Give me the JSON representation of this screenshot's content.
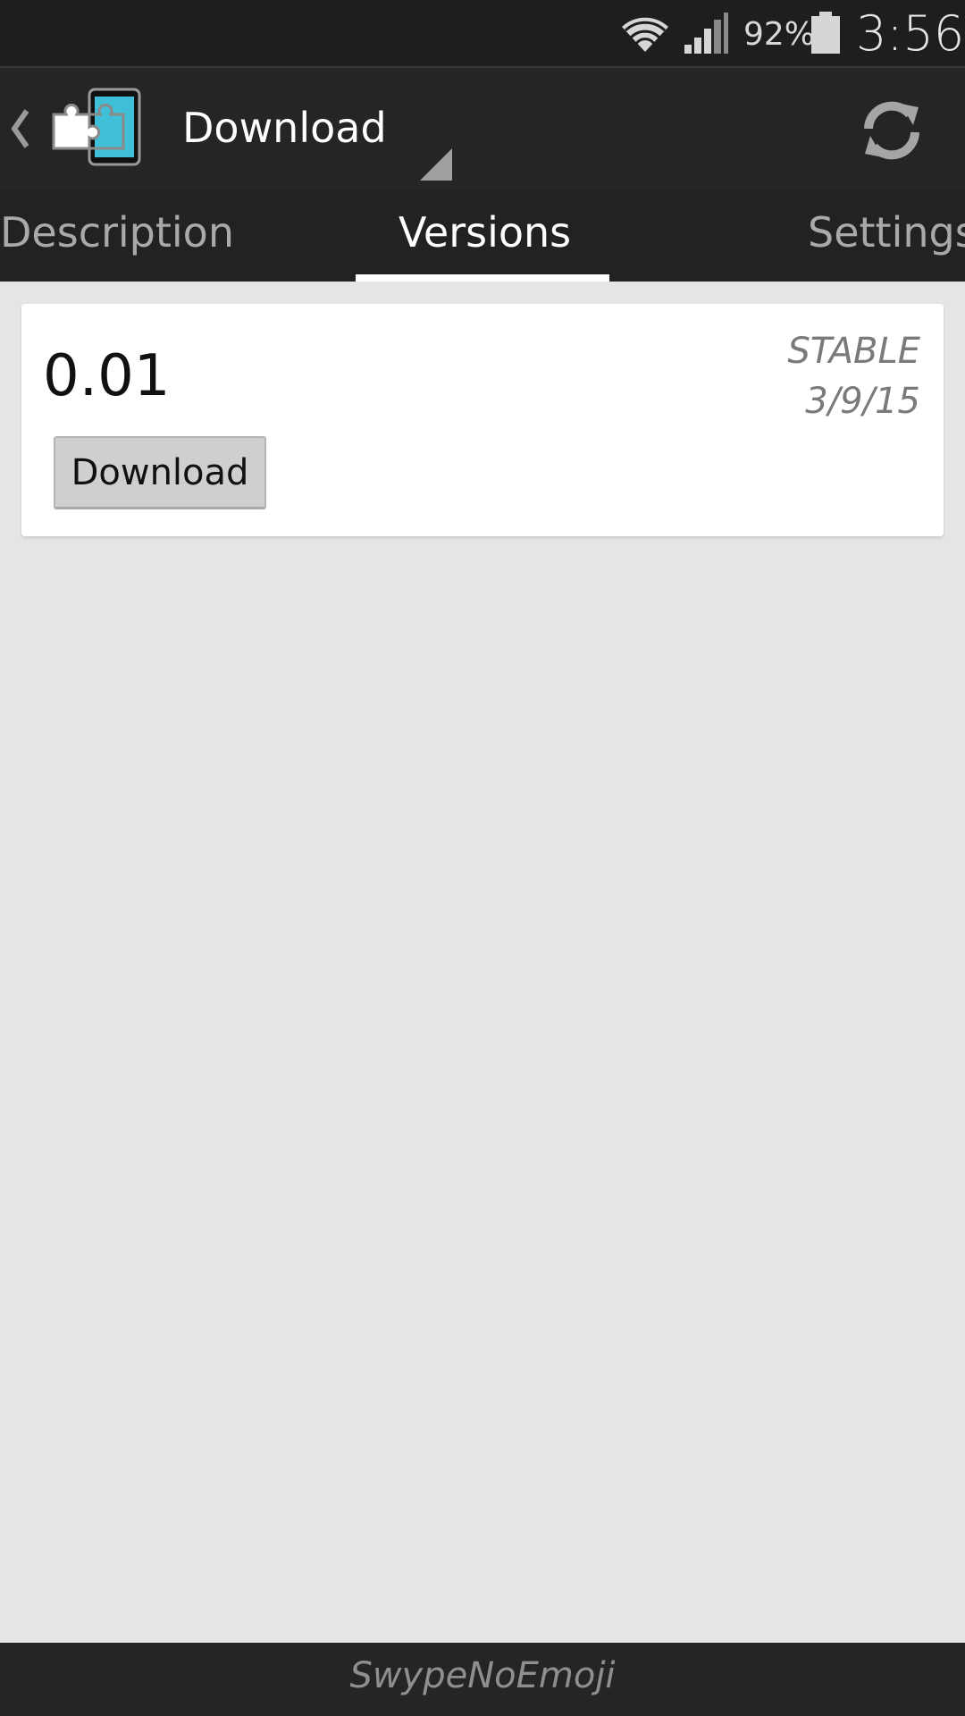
{
  "status_bar": {
    "battery_percent": "92%",
    "time": "3:56",
    "icons": [
      "wifi-icon",
      "signal-icon",
      "battery-icon"
    ]
  },
  "action_bar": {
    "title": "Download",
    "icons": [
      "back-chevron-icon",
      "app-logo-icon",
      "spinner-triangle-icon",
      "refresh-icon"
    ]
  },
  "tabs": [
    {
      "label": "Description",
      "selected": false
    },
    {
      "label": "Versions",
      "selected": true
    },
    {
      "label": "Settings",
      "selected": false
    }
  ],
  "versions": [
    {
      "number": "0.01",
      "status": "STABLE",
      "date": "3/9/15",
      "button_label": "Download"
    }
  ],
  "bottom_bar": {
    "label": "SwypeNoEmoji"
  },
  "colors": {
    "status_bar_bg": "#1e1e1e",
    "action_bar_bg": "#252525",
    "tab_bar_bg": "#222222",
    "content_bg": "#e5e5e5",
    "logo_accent": "#3fbfd8"
  }
}
